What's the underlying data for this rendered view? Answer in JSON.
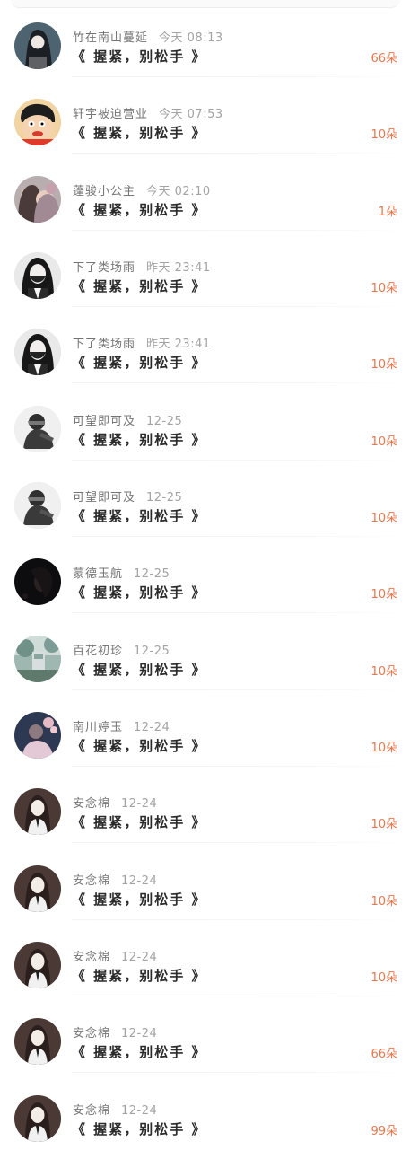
{
  "colors": {
    "name": "#757575",
    "time": "#a3a3a3",
    "message": "#2b2b2b",
    "count": "#e9774d"
  },
  "rows": [
    {
      "name": "竹在南山蔓延",
      "time": "今天 08:13",
      "message": "《 握紧，别松手 》",
      "count": "66朵",
      "avatar": "dark-hair-girl-avatar"
    },
    {
      "name": "轩宇被迫营业",
      "time": "今天 07:53",
      "message": "《 握紧，别松手 》",
      "count": "10朵",
      "avatar": "cartoon-boy-avatar"
    },
    {
      "name": "蓬骏小公主",
      "time": "今天 02:10",
      "message": "《 握紧，别松手 》",
      "count": "1朵",
      "avatar": "couple-photo-avatar"
    },
    {
      "name": "下了类场雨",
      "time": "昨天 23:41",
      "message": "《 握紧，别松手 》",
      "count": "10朵",
      "avatar": "masked-girl-avatar"
    },
    {
      "name": "下了类场雨",
      "time": "昨天 23:41",
      "message": "《 握紧，别松手 》",
      "count": "10朵",
      "avatar": "masked-girl-avatar"
    },
    {
      "name": "可望即可及",
      "time": "12-25",
      "message": "《 握紧，别松手 》",
      "count": "10朵",
      "avatar": "biker-sketch-avatar"
    },
    {
      "name": "可望即可及",
      "time": "12-25",
      "message": "《 握紧，别松手 》",
      "count": "10朵",
      "avatar": "biker-sketch-avatar"
    },
    {
      "name": "蒙德玉航",
      "time": "12-25",
      "message": "《 握紧，别松手 》",
      "count": "10朵",
      "avatar": "dark-portrait-avatar"
    },
    {
      "name": "百花初珍",
      "time": "12-25",
      "message": "《 握紧，别松手 》",
      "count": "10朵",
      "avatar": "garden-scene-avatar"
    },
    {
      "name": "南川婷玉",
      "time": "12-24",
      "message": "《 握紧，别松手 》",
      "count": "10朵",
      "avatar": "flower-girl-avatar"
    },
    {
      "name": "安念棉",
      "time": "12-24",
      "message": "《 握紧，别松手 》",
      "count": "10朵",
      "avatar": "school-girl-avatar"
    },
    {
      "name": "安念棉",
      "time": "12-24",
      "message": "《 握紧，别松手 》",
      "count": "10朵",
      "avatar": "school-girl-avatar"
    },
    {
      "name": "安念棉",
      "time": "12-24",
      "message": "《 握紧，别松手 》",
      "count": "10朵",
      "avatar": "school-girl-avatar"
    },
    {
      "name": "安念棉",
      "time": "12-24",
      "message": "《 握紧，别松手 》",
      "count": "66朵",
      "avatar": "school-girl-avatar"
    },
    {
      "name": "安念棉",
      "time": "12-24",
      "message": "《 握紧，别松手 》",
      "count": "99朵",
      "avatar": "school-girl-avatar"
    }
  ]
}
